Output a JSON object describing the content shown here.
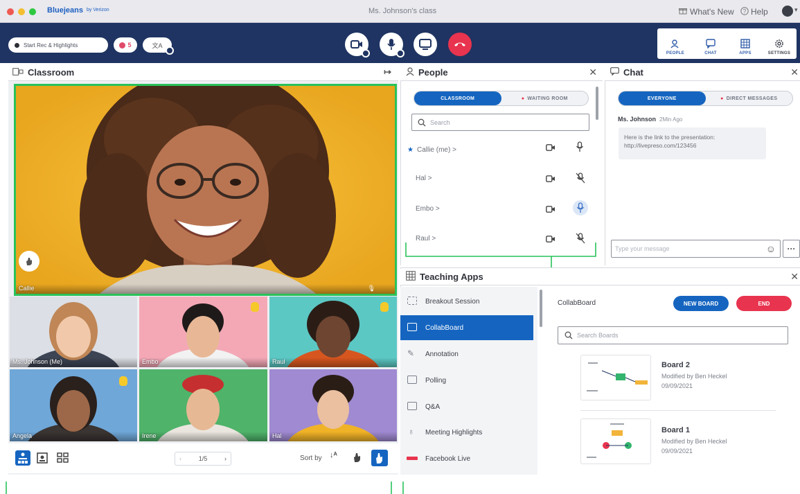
{
  "titlebar": {
    "brand": "Bluejeans",
    "brand_suffix": "by Verizon",
    "window_title": "Ms. Johnson's class",
    "whats_new": "What's New",
    "help": "Help"
  },
  "toolbar": {
    "record_label": "Start Rec & Highlights",
    "participants_count": "5",
    "tabs": [
      {
        "label": "PEOPLE"
      },
      {
        "label": "CHAT"
      },
      {
        "label": "APPS"
      },
      {
        "label": "SETTINGS"
      }
    ]
  },
  "classroom": {
    "title": "Classroom",
    "main_speaker": "Callie",
    "tiles": [
      {
        "name": "Ms. Johnson (Me)"
      },
      {
        "name": "Embo"
      },
      {
        "name": "Raul"
      },
      {
        "name": "Angela"
      },
      {
        "name": "Irene"
      },
      {
        "name": "Hal"
      }
    ],
    "pagination": "1/5",
    "sort_label": "Sort by"
  },
  "people": {
    "title": "People",
    "tab_classroom": "CLASSROOM",
    "tab_waiting": "WAITING ROOM",
    "search_placeholder": "Search",
    "rows": [
      {
        "name": "Callie (me) >"
      },
      {
        "name": "Hal >"
      },
      {
        "name": "Embo >"
      },
      {
        "name": "Raul >"
      }
    ]
  },
  "chat": {
    "title": "Chat",
    "tab_everyone": "EVERYONE",
    "tab_direct": "DIRECT MESSAGES",
    "sender": "Ms. Johnson",
    "time": "2Min Ago",
    "message": "Here is the link to the presentation: http://livepreso.com/123456",
    "input_placeholder": "Type your message"
  },
  "teaching_apps": {
    "title": "Teaching Apps",
    "items": [
      {
        "label": "Breakout Session",
        "icon": "breakout-icon"
      },
      {
        "label": "CollabBoard",
        "icon": "board-icon"
      },
      {
        "label": "Annotation",
        "icon": "pen-icon"
      },
      {
        "label": "Polling",
        "icon": "poll-icon"
      },
      {
        "label": "Q&A",
        "icon": "qa-icon"
      },
      {
        "label": "Meeting Highlights",
        "icon": "bulb-icon"
      },
      {
        "label": "Facebook Live",
        "icon": "facebook-live-icon"
      }
    ],
    "collab": {
      "title": "CollabBoard",
      "new_board": "NEW BOARD",
      "end": "END",
      "search_placeholder": "Search Boards",
      "boards": [
        {
          "name": "Board 2",
          "modified": "Modified by Ben Heckel",
          "date": "09/09/2021"
        },
        {
          "name": "Board 1",
          "modified": "Modified by Ben Heckel",
          "date": "09/09/2021"
        }
      ]
    }
  },
  "colors": {
    "toolbar": "#1f3462",
    "accent": "#1565c0",
    "end_call": "#e8344e",
    "active_speaker": "#29c25a"
  }
}
